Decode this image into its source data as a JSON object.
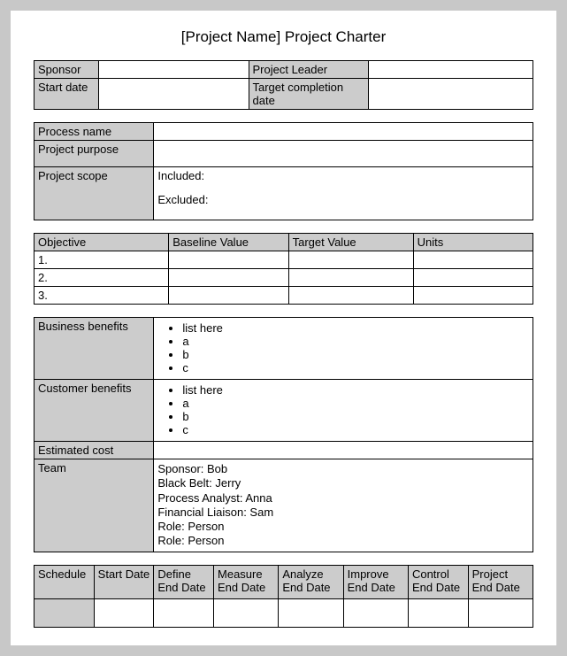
{
  "title": "[Project Name] Project Charter",
  "header": {
    "sponsor_label": "Sponsor",
    "sponsor_value": "",
    "project_leader_label": "Project Leader",
    "project_leader_value": "",
    "start_date_label": "Start date",
    "start_date_value": "",
    "target_date_label": "Target completion date",
    "target_date_value": ""
  },
  "process": {
    "name_label": "Process name",
    "name_value": "",
    "purpose_label": "Project purpose",
    "purpose_value": "",
    "scope_label": "Project scope",
    "scope_included_label": "Included:",
    "scope_excluded_label": "Excluded:"
  },
  "objectives": {
    "col1": "Objective",
    "col2": "Baseline Value",
    "col3": "Target Value",
    "col4": "Units",
    "rows": [
      "1.",
      "2.",
      "3."
    ]
  },
  "benefits": {
    "business_label": "Business benefits",
    "business_items": [
      "list here",
      "a",
      "b",
      "c"
    ],
    "customer_label": "Customer benefits",
    "customer_items": [
      "list here",
      "a",
      "b",
      "c"
    ],
    "estimated_cost_label": "Estimated cost",
    "estimated_cost_value": "",
    "team_label": "Team",
    "team_members": [
      "Sponsor: Bob",
      "Black Belt: Jerry",
      "Process Analyst: Anna",
      "Financial Liaison: Sam",
      "Role: Person",
      "Role: Person"
    ]
  },
  "schedule": {
    "col1": "Schedule",
    "col2": "Start Date",
    "col3": "Define End Date",
    "col4": "Measure End Date",
    "col5": "Analyze End Date",
    "col6": "Improve End Date",
    "col7": "Control End Date",
    "col8": "Project End Date"
  }
}
